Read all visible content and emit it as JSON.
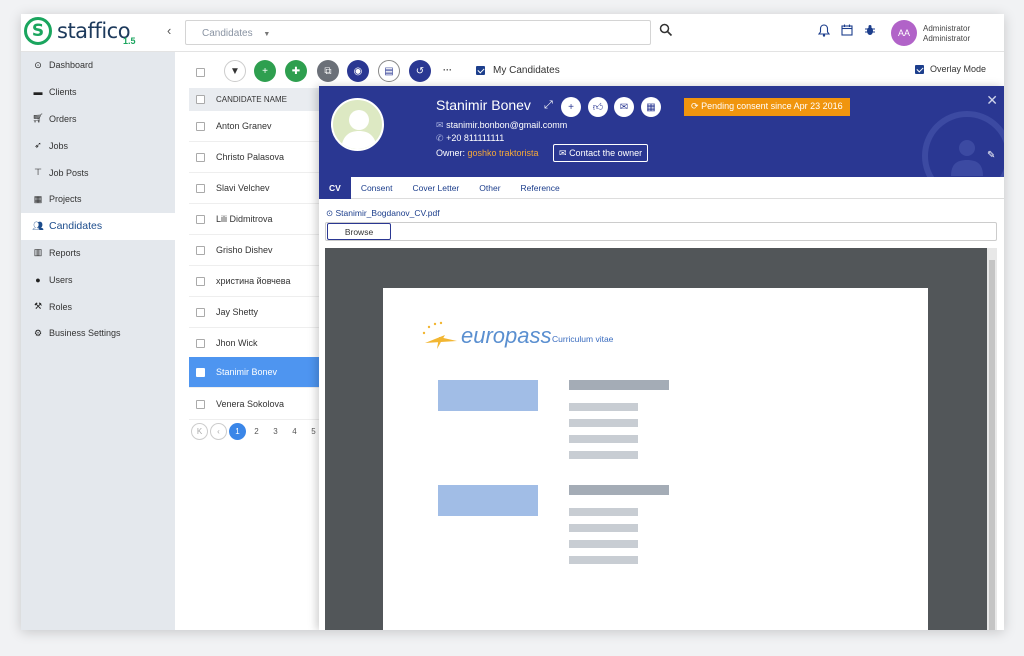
{
  "app": {
    "brand": "staffico",
    "version": "1.5"
  },
  "search": {
    "placeholder": "Candidates"
  },
  "user": {
    "initials": "AA",
    "name_line1": "Administrator",
    "name_line2": "Administrator"
  },
  "sidebar": {
    "items": [
      {
        "label": "Dashboard",
        "icon": "dashboard-icon"
      },
      {
        "label": "Clients",
        "icon": "clients-icon"
      },
      {
        "label": "Orders",
        "icon": "cart-icon"
      },
      {
        "label": "Jobs",
        "icon": "rocket-icon"
      },
      {
        "label": "Job Posts",
        "icon": "pin-icon"
      },
      {
        "label": "Projects",
        "icon": "grid-icon"
      },
      {
        "label": "Candidates",
        "icon": "users-icon"
      },
      {
        "label": "Reports",
        "icon": "bar-chart-icon"
      },
      {
        "label": "Users",
        "icon": "user-icon"
      },
      {
        "label": "Roles",
        "icon": "gavel-icon"
      },
      {
        "label": "Business Settings",
        "icon": "gear-icon"
      }
    ]
  },
  "toolbar": {
    "my_candidates": "My Candidates",
    "overlay_mode": "Overlay Mode",
    "more": "···"
  },
  "list": {
    "header": "CANDIDATE NAME",
    "rows": [
      "Anton Granev",
      "Christo Palasova",
      "Slavi Velchev",
      "Lili Didmitrova",
      "Grisho Dishev",
      "христина йовчева",
      "Jay Shetty",
      "Jhon Wick",
      "Stanimir Bonev",
      "Venera Sokolova"
    ],
    "selected_index": 8
  },
  "pager": {
    "first": "K",
    "prev": "‹",
    "pages": [
      "1",
      "2",
      "3",
      "4",
      "5"
    ],
    "current": "1"
  },
  "candidate": {
    "name": "Stanimir Bonev",
    "email": "stanimir.bonbon@gmail.comm",
    "phone": "+20 811111111",
    "owner_label": "Owner:",
    "owner_name": "goshko traktorista",
    "contact_button": "Contact the owner",
    "pending": "Pending consent since Apr 23 2016"
  },
  "tabs": [
    "CV",
    "Consent",
    "Cover Letter",
    "Other",
    "Reference"
  ],
  "document": {
    "file_name": "Stanimir_Bogdanov_CV.pdf",
    "browse_label": "Browse",
    "logo_text": "europass",
    "cv_label": "Curriculum vitae"
  },
  "colors": {
    "brand": "#1aa55e",
    "header_bg": "#2a3792",
    "pending": "#f0950e",
    "selected_row": "#4e95f0"
  }
}
